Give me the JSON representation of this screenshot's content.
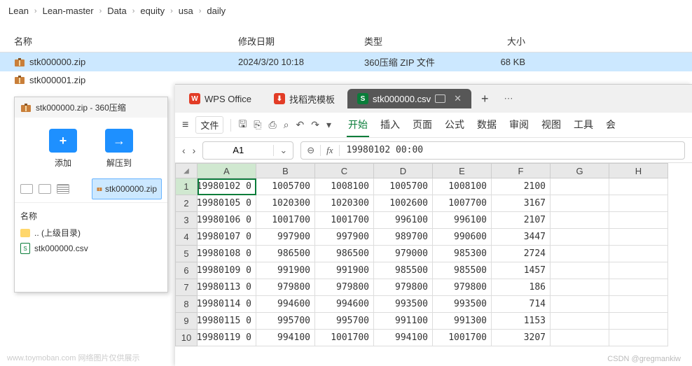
{
  "breadcrumb": [
    "Lean",
    "Lean-master",
    "Data",
    "equity",
    "usa",
    "daily"
  ],
  "columns": {
    "name": "名称",
    "modified": "修改日期",
    "type": "类型",
    "size": "大小"
  },
  "files": [
    {
      "name": "stk000000.zip",
      "modified": "2024/3/20 10:18",
      "type": "360压缩 ZIP 文件",
      "size": "68 KB",
      "selected": true
    },
    {
      "name": "stk000001.zip",
      "modified": "",
      "type": "",
      "size": "",
      "selected": false
    }
  ],
  "archive": {
    "title": "stk000000.zip - 360压缩",
    "add": "添加",
    "extract": "解压到",
    "selected_file": "stk000000.zip",
    "list_title": "名称",
    "items": [
      {
        "label": ".. (上级目录)",
        "icon": "folder"
      },
      {
        "label": "stk000000.csv",
        "icon": "csv"
      }
    ]
  },
  "wps": {
    "tabs": [
      {
        "label": "WPS Office",
        "icon_bg": "#e23c26",
        "icon_text": "W",
        "active": false
      },
      {
        "label": "找稻壳模板",
        "icon_bg": "#e23c26",
        "icon_text": "⬇",
        "active": false
      },
      {
        "label": "stk000000.csv",
        "icon_bg": "#0a7d3a",
        "icon_text": "S",
        "active": true
      }
    ],
    "file_label": "文件",
    "menu": [
      "开始",
      "插入",
      "页面",
      "公式",
      "数据",
      "审阅",
      "视图",
      "工具",
      "会"
    ],
    "active_menu": "开始",
    "cell_ref": "A1",
    "formula_value": "19980102 00:00",
    "chart_data": {
      "type": "table",
      "columns": [
        "A",
        "B",
        "C",
        "D",
        "E",
        "F",
        "G",
        "H"
      ],
      "rows": [
        [
          "19980102 0",
          "1005700",
          "1008100",
          "1005700",
          "1008100",
          "2100",
          "",
          ""
        ],
        [
          "19980105 0",
          "1020300",
          "1020300",
          "1002600",
          "1007700",
          "3167",
          "",
          ""
        ],
        [
          "19980106 0",
          "1001700",
          "1001700",
          "996100",
          "996100",
          "2107",
          "",
          ""
        ],
        [
          "19980107 0",
          "997900",
          "997900",
          "989700",
          "990600",
          "3447",
          "",
          ""
        ],
        [
          "19980108 0",
          "986500",
          "986500",
          "979000",
          "985300",
          "2724",
          "",
          ""
        ],
        [
          "19980109 0",
          "991900",
          "991900",
          "985500",
          "985500",
          "1457",
          "",
          ""
        ],
        [
          "19980113 0",
          "979800",
          "979800",
          "979800",
          "979800",
          "186",
          "",
          ""
        ],
        [
          "19980114 0",
          "994600",
          "994600",
          "993500",
          "993500",
          "714",
          "",
          ""
        ],
        [
          "19980115 0",
          "995700",
          "995700",
          "991100",
          "991300",
          "1153",
          "",
          ""
        ],
        [
          "19980119 0",
          "994100",
          "1001700",
          "994100",
          "1001700",
          "3207",
          "",
          ""
        ]
      ]
    }
  },
  "watermark": {
    "left": "www.toymoban.com  网络图片仅供展示",
    "right": "CSDN @gregmankiw"
  }
}
